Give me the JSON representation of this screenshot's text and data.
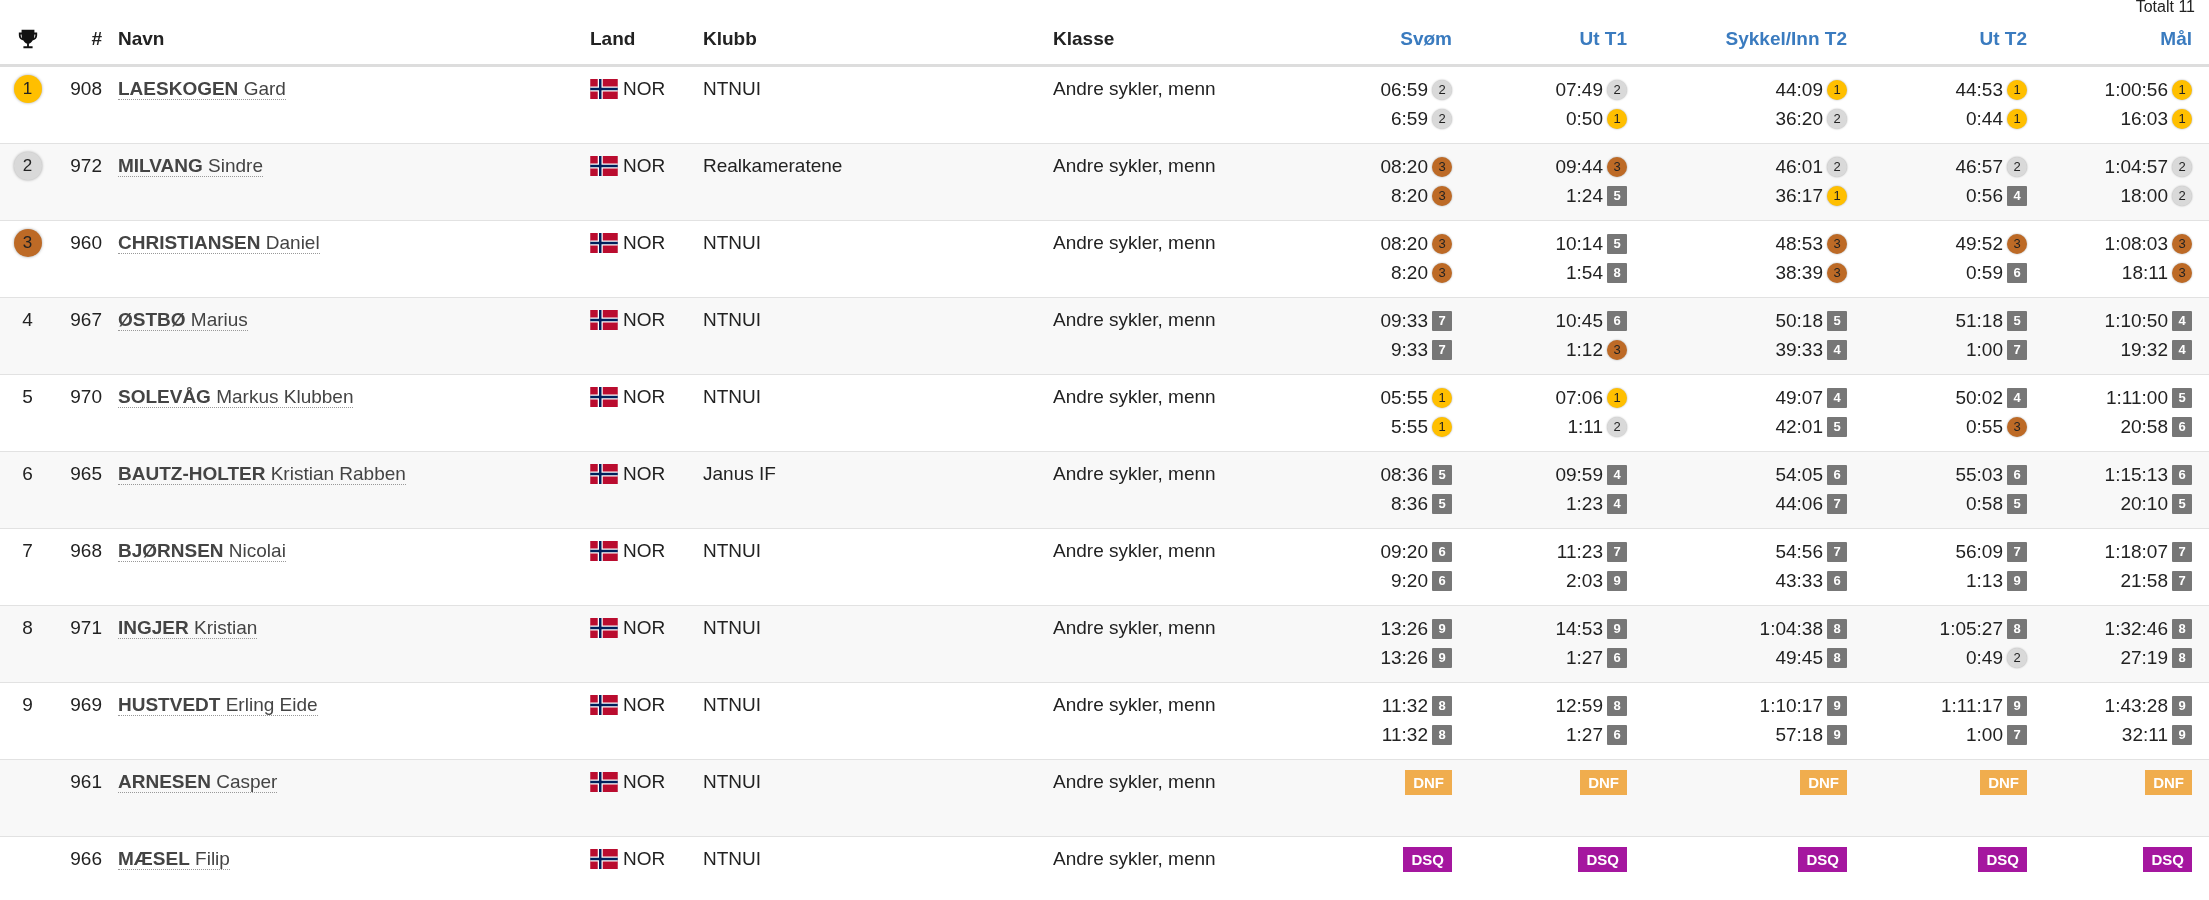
{
  "total": "Totalt 11",
  "columns": [
    "#",
    "Navn",
    "Land",
    "Klubb",
    "Klasse",
    "Svøm",
    "Ut T1",
    "Sykkel/Inn T2",
    "Ut T2",
    "Mål"
  ],
  "rows": [
    {
      "rank": "1",
      "kind": "gold",
      "bib": "908",
      "name": "**LAESKOGEN** Gard",
      "country": "NOR",
      "club": "NTNUI",
      "class": "Andre sykler, menn",
      "splits": [
        {
          "lines": [
            {
              "time": "06:59",
              "place": "2",
              "kind": "silver"
            },
            {
              "time": "6:59",
              "place": "2",
              "kind": "silver"
            }
          ]
        },
        {
          "lines": [
            {
              "time": "07:49",
              "place": "2",
              "kind": "silver"
            },
            {
              "time": "0:50",
              "place": "1",
              "kind": "gold"
            }
          ]
        },
        {
          "lines": [
            {
              "time": "44:09",
              "place": "1",
              "kind": "gold"
            },
            {
              "time": "36:20",
              "place": "2",
              "kind": "silver"
            }
          ]
        },
        {
          "lines": [
            {
              "time": "44:53",
              "place": "1",
              "kind": "gold"
            },
            {
              "time": "0:44",
              "place": "1",
              "kind": "gold"
            }
          ]
        },
        {
          "lines": [
            {
              "time": "1:00:56",
              "place": "1",
              "kind": "gold"
            },
            {
              "time": "16:03",
              "place": "1",
              "kind": "gold"
            }
          ]
        }
      ]
    },
    {
      "rank": "2",
      "kind": "silver",
      "bib": "972",
      "name": "**MILVANG** Sindre",
      "country": "NOR",
      "club": "Realkameratene",
      "class": "Andre sykler, menn",
      "splits": [
        {
          "lines": [
            {
              "time": "08:20",
              "place": "3",
              "kind": "bronze"
            },
            {
              "time": "8:20",
              "place": "3",
              "kind": "bronze"
            }
          ]
        },
        {
          "lines": [
            {
              "time": "09:44",
              "place": "3",
              "kind": "bronze"
            },
            {
              "time": "1:24",
              "place": "5",
              "kind": "plain"
            }
          ]
        },
        {
          "lines": [
            {
              "time": "46:01",
              "place": "2",
              "kind": "silver"
            },
            {
              "time": "36:17",
              "place": "1",
              "kind": "gold"
            }
          ]
        },
        {
          "lines": [
            {
              "time": "46:57",
              "place": "2",
              "kind": "silver"
            },
            {
              "time": "0:56",
              "place": "4",
              "kind": "plain"
            }
          ]
        },
        {
          "lines": [
            {
              "time": "1:04:57",
              "place": "2",
              "kind": "silver"
            },
            {
              "time": "18:00",
              "place": "2",
              "kind": "silver"
            }
          ]
        }
      ]
    },
    {
      "rank": "3",
      "kind": "bronze",
      "bib": "960",
      "name": "**CHRISTIANSEN** Daniel",
      "country": "NOR",
      "club": "NTNUI",
      "class": "Andre sykler, menn",
      "splits": [
        {
          "lines": [
            {
              "time": "08:20",
              "place": "3",
              "kind": "bronze"
            },
            {
              "time": "8:20",
              "place": "3",
              "kind": "bronze"
            }
          ]
        },
        {
          "lines": [
            {
              "time": "10:14",
              "place": "5",
              "kind": "plain"
            },
            {
              "time": "1:54",
              "place": "8",
              "kind": "plain"
            }
          ]
        },
        {
          "lines": [
            {
              "time": "48:53",
              "place": "3",
              "kind": "bronze"
            },
            {
              "time": "38:39",
              "place": "3",
              "kind": "bronze"
            }
          ]
        },
        {
          "lines": [
            {
              "time": "49:52",
              "place": "3",
              "kind": "bronze"
            },
            {
              "time": "0:59",
              "place": "6",
              "kind": "plain"
            }
          ]
        },
        {
          "lines": [
            {
              "time": "1:08:03",
              "place": "3",
              "kind": "bronze"
            },
            {
              "time": "18:11",
              "place": "3",
              "kind": "bronze"
            }
          ]
        }
      ]
    },
    {
      "rank": "4",
      "kind": "plain",
      "bib": "967",
      "name": "**ØSTBØ** Marius",
      "country": "NOR",
      "club": "NTNUI",
      "class": "Andre sykler, menn",
      "splits": [
        {
          "lines": [
            {
              "time": "09:33",
              "place": "7",
              "kind": "plain"
            },
            {
              "time": "9:33",
              "place": "7",
              "kind": "plain"
            }
          ]
        },
        {
          "lines": [
            {
              "time": "10:45",
              "place": "6",
              "kind": "plain"
            },
            {
              "time": "1:12",
              "place": "3",
              "kind": "bronze"
            }
          ]
        },
        {
          "lines": [
            {
              "time": "50:18",
              "place": "5",
              "kind": "plain"
            },
            {
              "time": "39:33",
              "place": "4",
              "kind": "plain"
            }
          ]
        },
        {
          "lines": [
            {
              "time": "51:18",
              "place": "5",
              "kind": "plain"
            },
            {
              "time": "1:00",
              "place": "7",
              "kind": "plain"
            }
          ]
        },
        {
          "lines": [
            {
              "time": "1:10:50",
              "place": "4",
              "kind": "plain"
            },
            {
              "time": "19:32",
              "place": "4",
              "kind": "plain"
            }
          ]
        }
      ]
    },
    {
      "rank": "5",
      "kind": "plain",
      "bib": "970",
      "name": "**SOLEVÅG** Markus Klubben",
      "country": "NOR",
      "club": "NTNUI",
      "class": "Andre sykler, menn",
      "splits": [
        {
          "lines": [
            {
              "time": "05:55",
              "place": "1",
              "kind": "gold"
            },
            {
              "time": "5:55",
              "place": "1",
              "kind": "gold"
            }
          ]
        },
        {
          "lines": [
            {
              "time": "07:06",
              "place": "1",
              "kind": "gold"
            },
            {
              "time": "1:11",
              "place": "2",
              "kind": "silver"
            }
          ]
        },
        {
          "lines": [
            {
              "time": "49:07",
              "place": "4",
              "kind": "plain"
            },
            {
              "time": "42:01",
              "place": "5",
              "kind": "plain"
            }
          ]
        },
        {
          "lines": [
            {
              "time": "50:02",
              "place": "4",
              "kind": "plain"
            },
            {
              "time": "0:55",
              "place": "3",
              "kind": "bronze"
            }
          ]
        },
        {
          "lines": [
            {
              "time": "1:11:00",
              "place": "5",
              "kind": "plain"
            },
            {
              "time": "20:58",
              "place": "6",
              "kind": "plain"
            }
          ]
        }
      ]
    },
    {
      "rank": "6",
      "kind": "plain",
      "bib": "965",
      "name": "**BAUTZ-HOLTER** Kristian Rabben",
      "country": "NOR",
      "club": "Janus IF",
      "class": "Andre sykler, menn",
      "splits": [
        {
          "lines": [
            {
              "time": "08:36",
              "place": "5",
              "kind": "plain"
            },
            {
              "time": "8:36",
              "place": "5",
              "kind": "plain"
            }
          ]
        },
        {
          "lines": [
            {
              "time": "09:59",
              "place": "4",
              "kind": "plain"
            },
            {
              "time": "1:23",
              "place": "4",
              "kind": "plain"
            }
          ]
        },
        {
          "lines": [
            {
              "time": "54:05",
              "place": "6",
              "kind": "plain"
            },
            {
              "time": "44:06",
              "place": "7",
              "kind": "plain"
            }
          ]
        },
        {
          "lines": [
            {
              "time": "55:03",
              "place": "6",
              "kind": "plain"
            },
            {
              "time": "0:58",
              "place": "5",
              "kind": "plain"
            }
          ]
        },
        {
          "lines": [
            {
              "time": "1:15:13",
              "place": "6",
              "kind": "plain"
            },
            {
              "time": "20:10",
              "place": "5",
              "kind": "plain"
            }
          ]
        }
      ]
    },
    {
      "rank": "7",
      "kind": "plain",
      "bib": "968",
      "name": "**BJØRNSEN** Nicolai",
      "country": "NOR",
      "club": "NTNUI",
      "class": "Andre sykler, menn",
      "splits": [
        {
          "lines": [
            {
              "time": "09:20",
              "place": "6",
              "kind": "plain"
            },
            {
              "time": "9:20",
              "place": "6",
              "kind": "plain"
            }
          ]
        },
        {
          "lines": [
            {
              "time": "11:23",
              "place": "7",
              "kind": "plain"
            },
            {
              "time": "2:03",
              "place": "9",
              "kind": "plain"
            }
          ]
        },
        {
          "lines": [
            {
              "time": "54:56",
              "place": "7",
              "kind": "plain"
            },
            {
              "time": "43:33",
              "place": "6",
              "kind": "plain"
            }
          ]
        },
        {
          "lines": [
            {
              "time": "56:09",
              "place": "7",
              "kind": "plain"
            },
            {
              "time": "1:13",
              "place": "9",
              "kind": "plain"
            }
          ]
        },
        {
          "lines": [
            {
              "time": "1:18:07",
              "place": "7",
              "kind": "plain"
            },
            {
              "time": "21:58",
              "place": "7",
              "kind": "plain"
            }
          ]
        }
      ]
    },
    {
      "rank": "8",
      "kind": "plain",
      "bib": "971",
      "name": "**INGJER** Kristian",
      "country": "NOR",
      "club": "NTNUI",
      "class": "Andre sykler, menn",
      "splits": [
        {
          "lines": [
            {
              "time": "13:26",
              "place": "9",
              "kind": "plain"
            },
            {
              "time": "13:26",
              "place": "9",
              "kind": "plain"
            }
          ]
        },
        {
          "lines": [
            {
              "time": "14:53",
              "place": "9",
              "kind": "plain"
            },
            {
              "time": "1:27",
              "place": "6",
              "kind": "plain"
            }
          ]
        },
        {
          "lines": [
            {
              "time": "1:04:38",
              "place": "8",
              "kind": "plain"
            },
            {
              "time": "49:45",
              "place": "8",
              "kind": "plain"
            }
          ]
        },
        {
          "lines": [
            {
              "time": "1:05:27",
              "place": "8",
              "kind": "plain"
            },
            {
              "time": "0:49",
              "place": "2",
              "kind": "silver"
            }
          ]
        },
        {
          "lines": [
            {
              "time": "1:32:46",
              "place": "8",
              "kind": "plain"
            },
            {
              "time": "27:19",
              "place": "8",
              "kind": "plain"
            }
          ]
        }
      ]
    },
    {
      "rank": "9",
      "kind": "plain",
      "bib": "969",
      "name": "**HUSTVEDT** Erling Eide",
      "country": "NOR",
      "club": "NTNUI",
      "class": "Andre sykler, menn",
      "splits": [
        {
          "lines": [
            {
              "time": "11:32",
              "place": "8",
              "kind": "plain"
            },
            {
              "time": "11:32",
              "place": "8",
              "kind": "plain"
            }
          ]
        },
        {
          "lines": [
            {
              "time": "12:59",
              "place": "8",
              "kind": "plain"
            },
            {
              "time": "1:27",
              "place": "6",
              "kind": "plain"
            }
          ]
        },
        {
          "lines": [
            {
              "time": "1:10:17",
              "place": "9",
              "kind": "plain"
            },
            {
              "time": "57:18",
              "place": "9",
              "kind": "plain"
            }
          ]
        },
        {
          "lines": [
            {
              "time": "1:11:17",
              "place": "9",
              "kind": "plain"
            },
            {
              "time": "1:00",
              "place": "7",
              "kind": "plain"
            }
          ]
        },
        {
          "lines": [
            {
              "time": "1:43:28",
              "place": "9",
              "kind": "plain"
            },
            {
              "time": "32:11",
              "place": "9",
              "kind": "plain"
            }
          ]
        }
      ]
    },
    {
      "bib": "961",
      "name": "**ARNESEN** Casper",
      "country": "NOR",
      "club": "NTNUI",
      "class": "Andre sykler, menn",
      "splits": [
        {
          "status": "DNF",
          "color": "#f0ad4e"
        },
        {
          "status": "DNF",
          "color": "#f0ad4e"
        },
        {
          "status": "DNF",
          "color": "#f0ad4e"
        },
        {
          "status": "DNF",
          "color": "#f0ad4e"
        },
        {
          "status": "DNF",
          "color": "#f0ad4e"
        }
      ]
    },
    {
      "bib": "966",
      "name": "**MÆSEL** Filip",
      "country": "NOR",
      "club": "NTNUI",
      "class": "Andre sykler, menn",
      "splits": [
        {
          "status": "DSQ",
          "color": "#a5169f"
        },
        {
          "status": "DSQ",
          "color": "#a5169f"
        },
        {
          "status": "DSQ",
          "color": "#a5169f"
        },
        {
          "status": "DSQ",
          "color": "#a5169f"
        },
        {
          "status": "DSQ",
          "color": "#a5169f"
        }
      ]
    }
  ]
}
